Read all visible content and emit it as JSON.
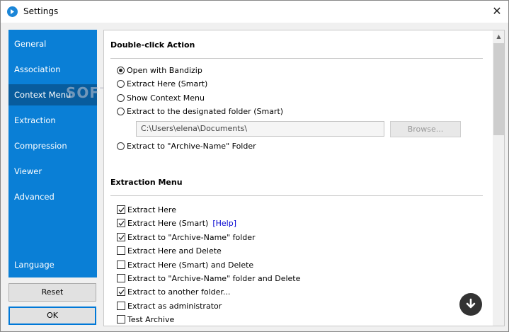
{
  "window": {
    "title": "Settings",
    "close_glyph": "✕"
  },
  "sidebar": {
    "items": [
      {
        "label": "General"
      },
      {
        "label": "Association"
      },
      {
        "label": "Context Menu"
      },
      {
        "label": "Extraction"
      },
      {
        "label": "Compression"
      },
      {
        "label": "Viewer"
      },
      {
        "label": "Advanced"
      }
    ],
    "active_index": 2,
    "bottom_item": {
      "label": "Language"
    },
    "watermark": "SOFTPED"
  },
  "buttons": {
    "reset": "Reset",
    "ok": "OK"
  },
  "double_click": {
    "title": "Double-click Action",
    "options": [
      {
        "label": "Open with Bandizip",
        "selected": true
      },
      {
        "label": "Extract Here (Smart)",
        "selected": false
      },
      {
        "label": "Show Context Menu",
        "selected": false
      },
      {
        "label": "Extract to the designated folder (Smart)",
        "selected": false
      },
      {
        "label": "Extract to \"Archive-Name\" Folder",
        "selected": false
      }
    ],
    "folder_value": "C:\\Users\\elena\\Documents\\",
    "browse_label": "Browse..."
  },
  "extraction_menu": {
    "title": "Extraction Menu",
    "help_label": "[Help]",
    "items": [
      {
        "label": "Extract Here",
        "checked": true
      },
      {
        "label": "Extract Here (Smart)",
        "checked": true
      },
      {
        "label": "Extract to \"Archive-Name\" folder",
        "checked": true
      },
      {
        "label": "Extract Here and Delete",
        "checked": false
      },
      {
        "label": "Extract Here (Smart) and Delete",
        "checked": false
      },
      {
        "label": "Extract to \"Archive-Name\" folder and Delete",
        "checked": false
      },
      {
        "label": "Extract to another folder...",
        "checked": true
      },
      {
        "label": "Extract as administrator",
        "checked": false
      },
      {
        "label": "Test Archive",
        "checked": false
      }
    ]
  },
  "colors": {
    "sidebar_bg": "#0a7fd6",
    "sidebar_active": "#085c9d",
    "accent": "#0078d7"
  },
  "icons": {
    "app": "bandizip-logo-icon",
    "scroll_down": "arrow-down-icon"
  }
}
